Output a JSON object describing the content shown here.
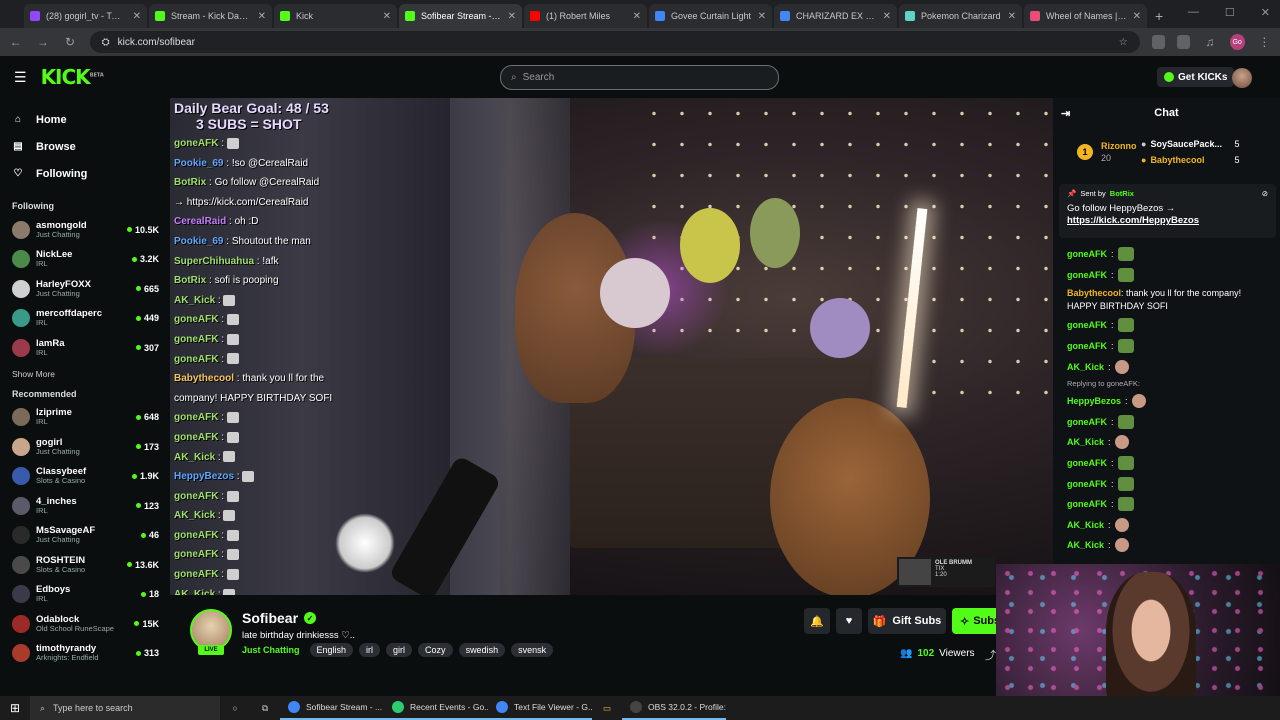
{
  "browser": {
    "tabs": [
      {
        "title": "(28) gogirl_tv - Twitch",
        "color": "#9146ff"
      },
      {
        "title": "Stream - Kick Dashboard",
        "color": "#53fc18"
      },
      {
        "title": "Kick",
        "color": "#53fc18"
      },
      {
        "title": "Sofibear Stream - Wa",
        "color": "#53fc18"
      },
      {
        "title": "(1) Robert Miles",
        "color": "#ff0000"
      },
      {
        "title": "Govee Curtain Light",
        "color": "#4285f4"
      },
      {
        "title": "CHARIZARD EX COLL",
        "color": "#4285f4"
      },
      {
        "title": "Pokemon Charizard",
        "color": "#5fd3c5"
      },
      {
        "title": "Wheel of Names | Ra",
        "color": "#e94e77"
      }
    ],
    "new_tab": "+",
    "url": "kick.com/sofibear",
    "profile_initials": "Go"
  },
  "header": {
    "logo": "KICK",
    "logo_badge": "BETA",
    "search_placeholder": "Search",
    "get_kicks": "Get KICKs"
  },
  "sidebar": {
    "nav": [
      {
        "label": "Home",
        "icon": "home-icon"
      },
      {
        "label": "Browse",
        "icon": "browse-icon"
      },
      {
        "label": "Following",
        "icon": "heart-icon"
      }
    ],
    "following_title": "Following",
    "following": [
      {
        "name": "asmongold",
        "category": "Just Chatting",
        "viewers": "10.5K",
        "color": "#8a7a6a"
      },
      {
        "name": "NickLee",
        "category": "IRL",
        "viewers": "3.2K",
        "color": "#4a8a4a"
      },
      {
        "name": "HarleyFOXX",
        "category": "Just Chatting",
        "viewers": "665",
        "color": "#d0d0d0"
      },
      {
        "name": "mercoffdaperc",
        "category": "IRL",
        "viewers": "449",
        "color": "#3a9a8a"
      },
      {
        "name": "lamRa",
        "category": "IRL",
        "viewers": "307",
        "color": "#9a3a4a"
      }
    ],
    "show_more": "Show More",
    "recommended_title": "Recommended",
    "recommended": [
      {
        "name": "lziprime",
        "category": "IRL",
        "viewers": "648",
        "color": "#7a6a5a"
      },
      {
        "name": "gogirl",
        "category": "Just Chatting",
        "viewers": "173",
        "color": "#c9a58b"
      },
      {
        "name": "Classybeef",
        "category": "Slots & Casino",
        "viewers": "1.9K",
        "color": "#3a5aaa"
      },
      {
        "name": "4_inches",
        "category": "IRL",
        "viewers": "123",
        "color": "#5a5a6a"
      },
      {
        "name": "MsSavageAF",
        "category": "Just Chatting",
        "viewers": "46",
        "color": "#2a2a2a"
      },
      {
        "name": "ROSHTEIN",
        "category": "Slots & Casino",
        "viewers": "13.6K",
        "color": "#4a4a4a"
      },
      {
        "name": "Edboys",
        "category": "IRL",
        "viewers": "18",
        "color": "#3a3a4a"
      },
      {
        "name": "Odablock",
        "category": "Old School RuneScape",
        "viewers": "15K",
        "color": "#9a2a2a"
      },
      {
        "name": "timothyrandy",
        "category": "Arknights: Endfield",
        "viewers": "313",
        "color": "#aa3a2a"
      }
    ]
  },
  "video": {
    "goal_line1": "Daily Bear Goal:  48 / 53",
    "goal_line2": "3 SUBS = SHOT",
    "overlay_chat": [
      {
        "user": "goneAFK",
        "text": ":",
        "cls": "uw",
        "emote": true
      },
      {
        "user": "Pookie_69",
        "text": ": !so @CerealRaid",
        "cls": "ub"
      },
      {
        "user": "BotRix",
        "text": ": Go follow @CerealRaid",
        "cls": "uw"
      },
      {
        "user": "",
        "text": "→ https://kick.com/CerealRaid",
        "cls": "uw"
      },
      {
        "user": "CerealRaid",
        "text": ": oh :D",
        "cls": "up"
      },
      {
        "user": "Pookie_69",
        "text": ": Shoutout the man",
        "cls": "ub"
      },
      {
        "user": "SuperChihuahua",
        "text": ": !afk",
        "cls": "uw"
      },
      {
        "user": "BotRix",
        "text": ": sofi is pooping",
        "cls": "uw"
      },
      {
        "user": "AK_Kick",
        "text": ":",
        "cls": "uw",
        "emote": true
      },
      {
        "user": "goneAFK",
        "text": ":",
        "cls": "uw",
        "emote": true
      },
      {
        "user": "goneAFK",
        "text": ":",
        "cls": "uw",
        "emote": true
      },
      {
        "user": "goneAFK",
        "text": ":",
        "cls": "uw",
        "emote": true
      },
      {
        "user": "Babythecool",
        "text": ": thank you ll for the",
        "cls": "uy"
      },
      {
        "user": "",
        "text": "company! HAPPY BIRTHDAY SOFI",
        "cls": "uw"
      },
      {
        "user": "goneAFK",
        "text": ":",
        "cls": "uw",
        "emote": true
      },
      {
        "user": "goneAFK",
        "text": ":",
        "cls": "uw",
        "emote": true
      },
      {
        "user": "AK_Kick",
        "text": ":",
        "cls": "uw",
        "emote": true
      },
      {
        "user": "HeppyBezos",
        "text": ":",
        "cls": "ub",
        "emote": true
      },
      {
        "user": "goneAFK",
        "text": ":",
        "cls": "uw",
        "emote": true
      },
      {
        "user": "AK_Kick",
        "text": ":",
        "cls": "uw",
        "emote": true
      },
      {
        "user": "goneAFK",
        "text": ":",
        "cls": "uw",
        "emote": true
      },
      {
        "user": "goneAFK",
        "text": ":",
        "cls": "uw",
        "emote": true
      },
      {
        "user": "goneAFK",
        "text": ":",
        "cls": "uw",
        "emote": true
      },
      {
        "user": "AK_Kick",
        "text": ":",
        "cls": "uw",
        "emote": true
      }
    ],
    "ole_title": "OLE BRUMM",
    "ole_sub": "TIX",
    "ole_time": "1:20"
  },
  "channel": {
    "name": "Sofibear",
    "live": "LIVE",
    "title": "late birthday drinkiesss ♡..",
    "category": "Just Chatting",
    "tags": [
      "English",
      "irl",
      "girl",
      "Cozy",
      "swedish",
      "svensk"
    ],
    "gift_subs": "Gift Subs",
    "subscribe": "Subs",
    "viewers_count": "102",
    "viewers_label": "Viewers"
  },
  "chat": {
    "title": "Chat",
    "leader_rank": "1",
    "leader_name": "Rizonno",
    "leader_count": "20",
    "leaders_right": [
      {
        "name": "SoySaucePack...",
        "count": "5"
      },
      {
        "name": "Babythecool",
        "count": "5"
      }
    ],
    "pinned_sent_by": "Sent by",
    "pinned_user": "BotRix",
    "pinned_msg": "Go follow HeppyBezos →",
    "pinned_link": "https://kick.com/HeppyBezos",
    "messages": [
      {
        "user": "goneAFK",
        "text": ":",
        "cls": "ua",
        "emote": "pepe"
      },
      {
        "user": "goneAFK",
        "text": ":",
        "cls": "ua",
        "emote": "pepe"
      },
      {
        "user": "Babythecool",
        "text": ": thank you ll for the company! HAPPY BIRTHDAY SOFI",
        "cls": "uy",
        "multi": true
      },
      {
        "user": "goneAFK",
        "text": ":",
        "cls": "ua",
        "emote": "pepe"
      },
      {
        "user": "goneAFK",
        "text": ":",
        "cls": "ua",
        "emote": "pepe"
      },
      {
        "user": "AK_Kick",
        "text": ":",
        "cls": "ua",
        "emote": "face"
      },
      {
        "reply": "Replying to goneAFK:"
      },
      {
        "user": "HeppyBezos",
        "text": ":",
        "cls": "ua",
        "emote": "face"
      },
      {
        "user": "goneAFK",
        "text": ":",
        "cls": "ua",
        "emote": "pepe"
      },
      {
        "user": "AK_Kick",
        "text": ":",
        "cls": "ua",
        "emote": "face"
      },
      {
        "user": "goneAFK",
        "text": ":",
        "cls": "ua",
        "emote": "pepe"
      },
      {
        "user": "goneAFK",
        "text": ":",
        "cls": "ua",
        "emote": "pepe"
      },
      {
        "user": "goneAFK",
        "text": ":",
        "cls": "ua",
        "emote": "pepe"
      },
      {
        "user": "AK_Kick",
        "text": ":",
        "cls": "ua",
        "emote": "face"
      },
      {
        "user": "AK_Kick",
        "text": ":",
        "cls": "ua",
        "emote": "face"
      }
    ]
  },
  "taskbar": {
    "search_placeholder": "Type here to search",
    "apps": [
      {
        "label": "Sofibear Stream - ...",
        "color": "#4285f4"
      },
      {
        "label": "Recent Events - Go...",
        "color": "#2ecc71"
      },
      {
        "label": "Text File Viewer - G...",
        "color": "#4285f4"
      },
      {
        "label": "OBS 32.0.2 - Profile:...",
        "color": "#444444"
      }
    ]
  }
}
